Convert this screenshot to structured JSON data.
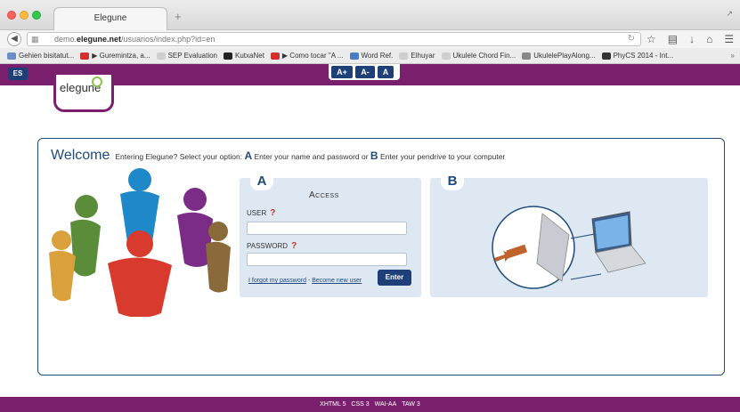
{
  "browser": {
    "tab_title": "Elegune",
    "url_prefix": "demo.",
    "url_domain": "elegune.net",
    "url_path": "/usuarios/index.php?id=en",
    "bookmarks": [
      {
        "label": "Gehien bisitatut...",
        "color": "#6b8ec9"
      },
      {
        "label": "▶ Guremintza, a...",
        "color": "#d32f2f"
      },
      {
        "label": "SEP Evaluation",
        "color": "#cfcfcf"
      },
      {
        "label": "KutxaNet",
        "color": "#222222"
      },
      {
        "label": "▶ Como tocar \"A ...",
        "color": "#d32f2f"
      },
      {
        "label": "Word Ref.",
        "color": "#4a7cc4"
      },
      {
        "label": "Elhuyar",
        "color": "#cfcfcf"
      },
      {
        "label": "Ukulele Chord Fin...",
        "color": "#cfcfcf"
      },
      {
        "label": "UkulelePlayAlong...",
        "color": "#888888"
      },
      {
        "label": "PhyCS 2014 - Int...",
        "color": "#333333"
      }
    ],
    "overflow": "»"
  },
  "site": {
    "lang": "ES",
    "font_buttons": [
      "A+",
      "A-",
      "A"
    ],
    "logo_text": "elegune",
    "brand_color": "#7a1f6e",
    "accent_color": "#1e3f78"
  },
  "welcome": {
    "title": "Welcome",
    "subtitle_1": "Entering Elegune? Select your option: ",
    "option_a": "A",
    "subtitle_2": " Enter your name and password or ",
    "option_b": "B",
    "subtitle_3": " Enter your pendrive to your computer"
  },
  "login": {
    "badge": "A",
    "heading": "Access",
    "user_label": "User",
    "user_value": "",
    "password_label": "Password",
    "password_value": "",
    "help_glyph": "?",
    "forgot_link": "I forgot my password",
    "separator": " - ",
    "register_link": "Become new user",
    "enter_button": "Enter"
  },
  "pendrive": {
    "badge": "B"
  },
  "footer": {
    "items": [
      "XHTML 5",
      "CSS 3",
      "WAI-AA",
      "TAW 3"
    ]
  }
}
